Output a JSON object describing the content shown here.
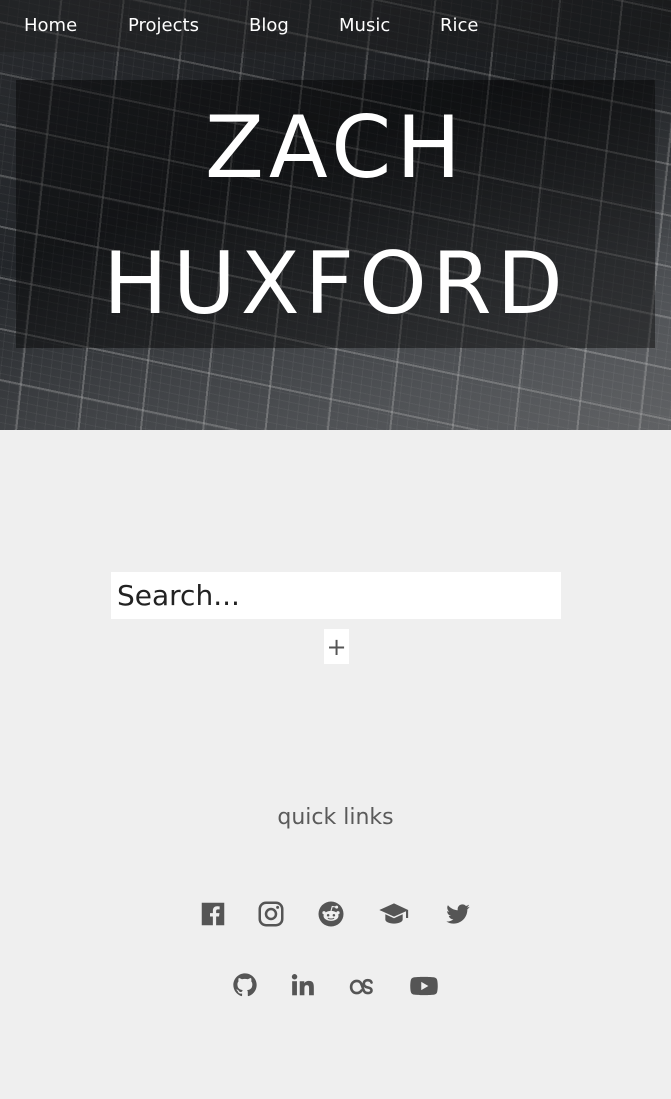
{
  "nav": {
    "items": [
      {
        "label": "Home"
      },
      {
        "label": "Projects"
      },
      {
        "label": "Blog"
      },
      {
        "label": "Music"
      },
      {
        "label": "Rice"
      }
    ]
  },
  "hero": {
    "title_line1": "ZACH",
    "title_line2": "HUXFORD"
  },
  "search": {
    "placeholder": "Search...",
    "value": ""
  },
  "add_button": {
    "label": "+"
  },
  "quick_links": {
    "title": "quick links",
    "icon_color": "#555555",
    "row1": [
      "facebook-icon",
      "instagram-icon",
      "reddit-icon",
      "graduation-cap-icon",
      "twitter-icon"
    ],
    "row2": [
      "github-icon",
      "linkedin-icon",
      "lastfm-icon",
      "youtube-icon"
    ]
  }
}
